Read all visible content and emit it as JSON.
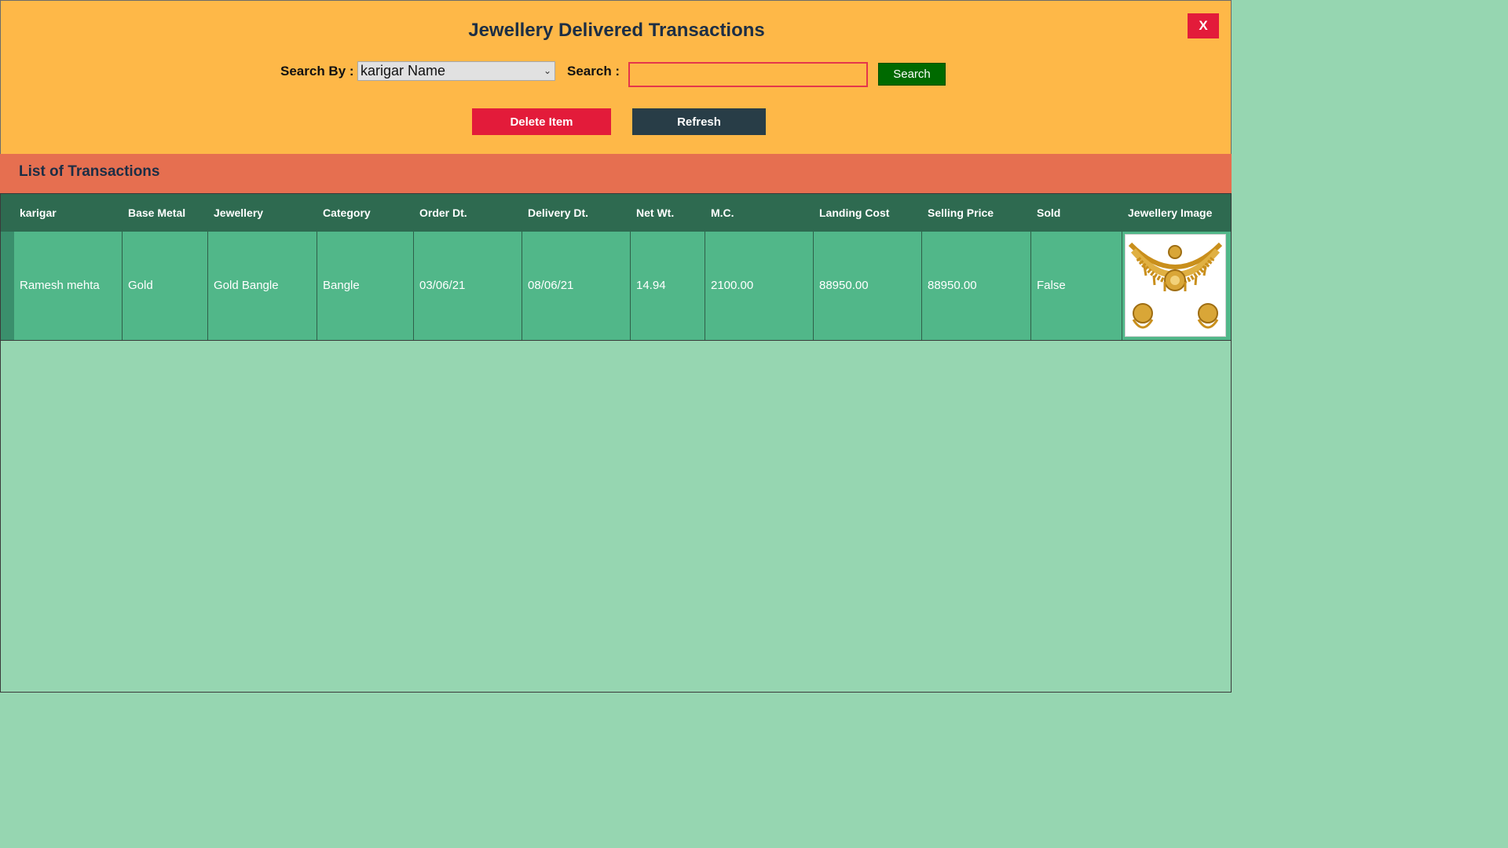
{
  "header": {
    "title": "Jewellery Delivered Transactions",
    "close_label": "X",
    "search_by_label": "Search By :",
    "search_by_value": "karigar Name",
    "search_label": "Search :",
    "search_value": "",
    "search_button": "Search",
    "delete_button": "Delete Item",
    "refresh_button": "Refresh"
  },
  "section": {
    "title": "List of Transactions"
  },
  "table": {
    "columns": [
      "karigar",
      "Base Metal",
      "Jewellery",
      "Category",
      "Order Dt.",
      "Delivery Dt.",
      "Net Wt.",
      "M.C.",
      "Landing Cost",
      "Selling Price",
      "Sold",
      "Jewellery Image"
    ],
    "rows": [
      {
        "karigar": "Ramesh mehta",
        "base_metal": "Gold",
        "jewellery": "Gold Bangle",
        "category": "Bangle",
        "order_dt": "03/06/21",
        "delivery_dt": "08/06/21",
        "net_wt": "14.94",
        "mc": "2100.00",
        "landing_cost": "88950.00",
        "selling_price": "88950.00",
        "sold": "False",
        "image": "jewellery-necklace-set-image"
      }
    ]
  },
  "colors": {
    "header_bg": "#feb848",
    "section_bg": "#e66f50",
    "table_header_bg": "#2e6a50",
    "row_bg": "#51b789",
    "grid_bg": "#96d6b1",
    "danger": "#e31b3a",
    "search_btn": "#006a00",
    "refresh_btn": "#283d47"
  }
}
